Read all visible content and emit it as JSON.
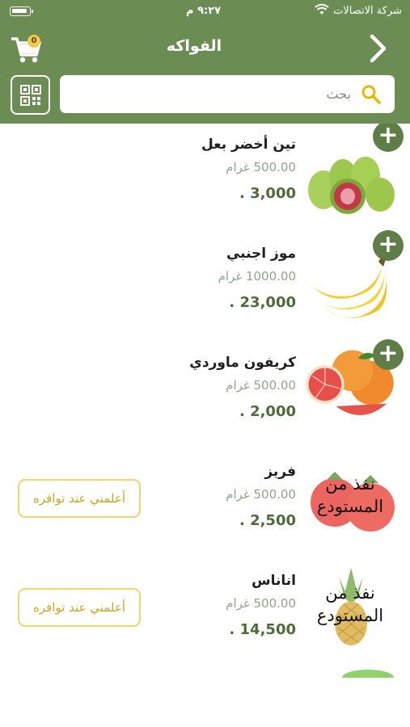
{
  "status_bar": {
    "carrier": "شركة الاتصالات",
    "time": "٩:٢٧ م"
  },
  "header": {
    "title": "الفواكه",
    "cart_count": "0"
  },
  "search": {
    "placeholder": "بحث"
  },
  "products": [
    {
      "name": "تين أخضر بعل",
      "weight": "500.00 غرام",
      "price": "3,000",
      "currency_mark": ".",
      "in_stock": true,
      "image": "figs"
    },
    {
      "name": "موز اجنبي",
      "weight": "1000.00 غرام",
      "price": "23,000",
      "currency_mark": ".",
      "in_stock": true,
      "image": "bananas"
    },
    {
      "name": "كريفون ماوردي",
      "weight": "500.00 غرام",
      "price": "2,000",
      "currency_mark": ".",
      "in_stock": true,
      "image": "grapefruit"
    },
    {
      "name": "فريز",
      "weight": "500.00 غرام",
      "price": "2,500",
      "currency_mark": ".",
      "in_stock": false,
      "image": "strawberry",
      "out_of_stock_label": "نفذ من المستودع",
      "notify_label": "أعلمني عند توافره"
    },
    {
      "name": "اناناس",
      "weight": "500.00 غرام",
      "price": "14,500",
      "currency_mark": ".",
      "in_stock": false,
      "image": "pineapple",
      "out_of_stock_label": "نفذ من المستودع",
      "notify_label": "أعلمني عند توافره"
    }
  ],
  "colors": {
    "header": "#6b8c52",
    "accent": "#5f7d47",
    "price": "#4e6a3a",
    "weight": "#8fa58a",
    "notify_border": "#f4d36a"
  },
  "icons": [
    "battery-icon",
    "wifi-icon",
    "cart-icon",
    "back-chevron-icon",
    "qr-code-icon",
    "search-icon",
    "add-icon"
  ]
}
